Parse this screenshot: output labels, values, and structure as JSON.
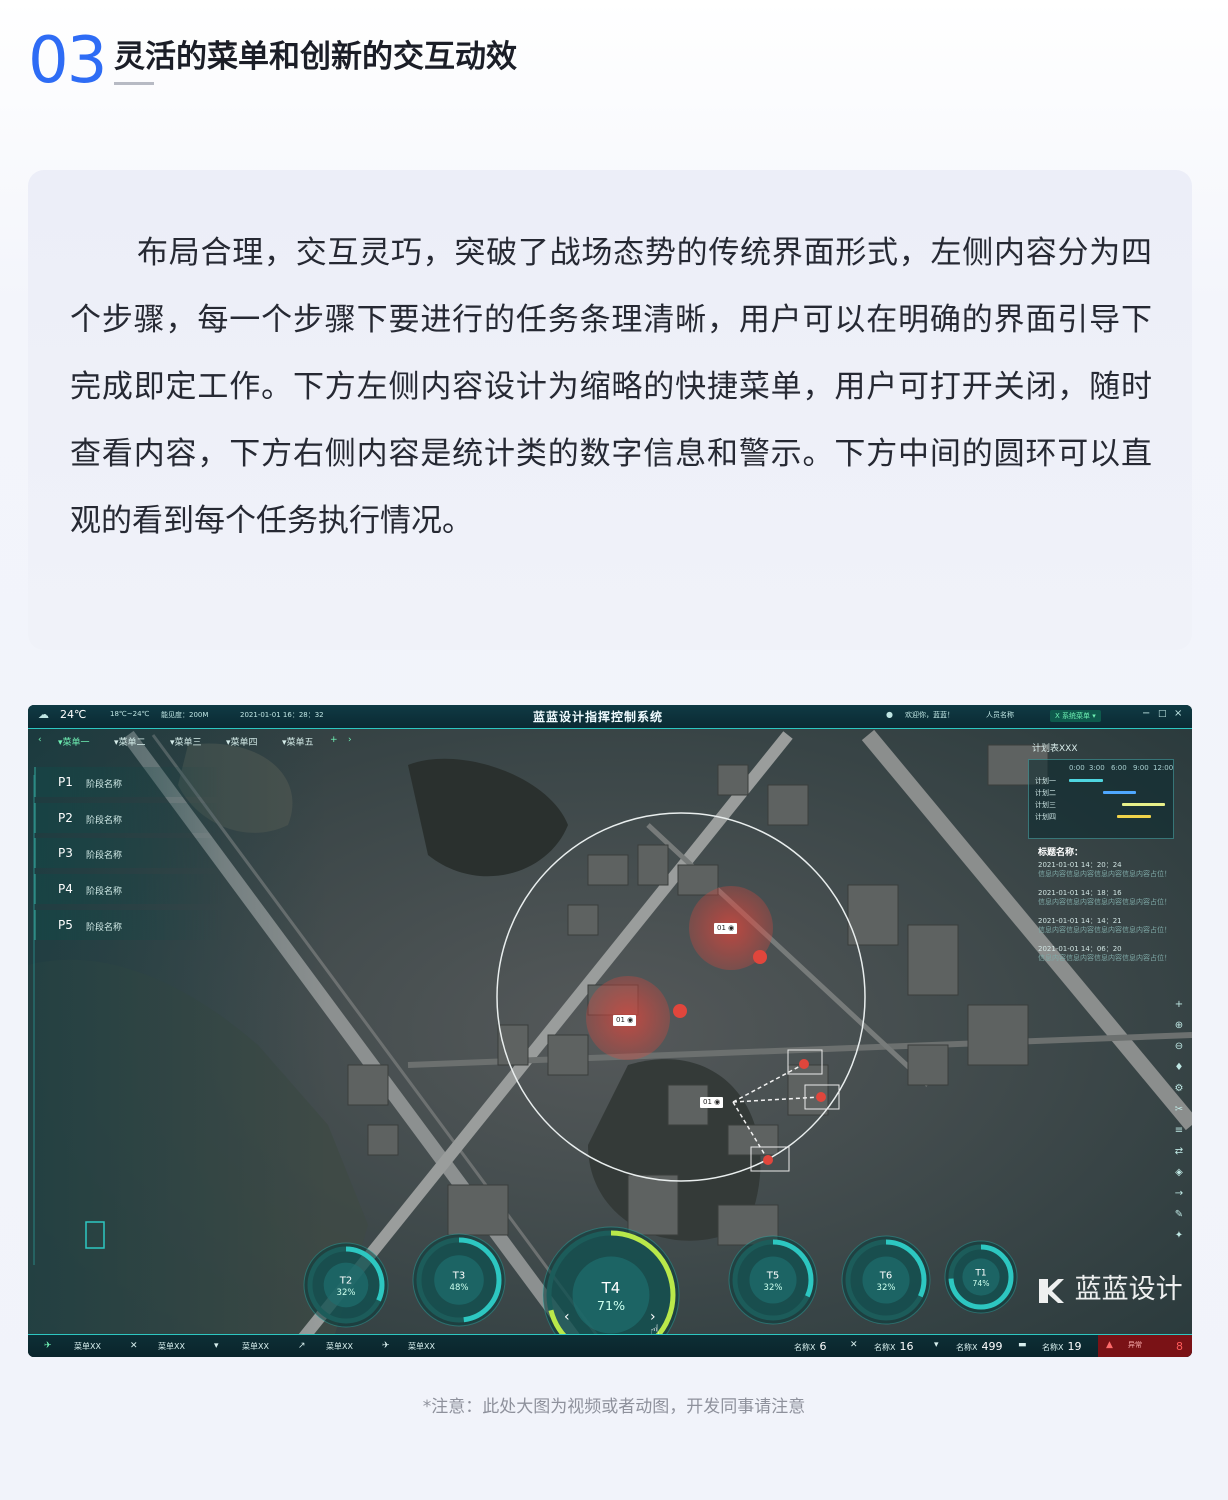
{
  "section": {
    "number": "03",
    "title": "灵活的菜单和创新的交互动效"
  },
  "description": "布局合理，交互灵巧，突破了战场态势的传统界面形式，左侧内容分为四个步骤，每一个步骤下要进行的任务条理清晰，用户可以在明确的界面引导下完成即定工作。下方左侧内容设计为缩略的快捷菜单，用户可打开关闭，随时查看内容，下方右侧内容是统计类的数字信息和警示。下方中间的圆环可以直观的看到每个任务执行情况。",
  "screen": {
    "topbar": {
      "temperature": "24℃",
      "temp_range": "18℃~24℃",
      "visibility": "能见度：200M",
      "datetime": "2021-01-01  16：28：32",
      "title": "蓝蓝设计指挥控制系统",
      "welcome": "欢迎你，蓝蓝！",
      "user_name": "人员名称",
      "system_menu": "X 系统菜单 ▾",
      "window_controls": [
        "−",
        "□",
        "×"
      ]
    },
    "menu_tabs": [
      "▾菜单一",
      "▾菜单二",
      "▾菜单三",
      "▾菜单四",
      "▾菜单五"
    ],
    "phases": [
      {
        "id": "P1",
        "name": "阶段名称"
      },
      {
        "id": "P2",
        "name": "阶段名称"
      },
      {
        "id": "P3",
        "name": "阶段名称"
      },
      {
        "id": "P4",
        "name": "阶段名称"
      },
      {
        "id": "P5",
        "name": "阶段名称"
      }
    ],
    "plan_panel": {
      "title": "计划表XXX",
      "times": [
        "0:00",
        "3:00",
        "6:00",
        "9:00",
        "12:00"
      ],
      "plans": [
        {
          "label": "计划一",
          "start": 0.0,
          "end": 0.35,
          "color": "#4fd6e0"
        },
        {
          "label": "计划二",
          "start": 0.35,
          "end": 0.7,
          "color": "#4fa8ff"
        },
        {
          "label": "计划三",
          "start": 0.55,
          "end": 1.0,
          "color": "#e8f08a"
        },
        {
          "label": "计划四",
          "start": 0.5,
          "end": 0.85,
          "color": "#f0d34a"
        }
      ],
      "alerts_title": "标题名称：",
      "alerts": [
        {
          "time": "2021-01-01 14：20：24",
          "msg": "信息内容信息内容信息内容信息内容占位！"
        },
        {
          "time": "2021-01-01 14：18：16",
          "msg": "信息内容信息内容信息内容信息内容占位！"
        },
        {
          "time": "2021-01-01 14：14：21",
          "msg": "信息内容信息内容信息内容信息内容占位！"
        },
        {
          "time": "2021-01-01 14：06：20",
          "msg": "信息内容信息内容信息内容信息内容占位！"
        }
      ]
    },
    "map_markers": [
      {
        "label": "01"
      },
      {
        "label": "01"
      },
      {
        "label": "01"
      }
    ],
    "tasks": [
      {
        "name": "T2",
        "pct": "32%",
        "value": 0.32
      },
      {
        "name": "T3",
        "pct": "48%",
        "value": 0.48
      },
      {
        "name": "T4",
        "pct": "71%",
        "value": 0.71
      },
      {
        "name": "T5",
        "pct": "32%",
        "value": 0.32
      },
      {
        "name": "T6",
        "pct": "32%",
        "value": 0.32
      },
      {
        "name": "T1",
        "pct": "74%",
        "value": 0.74
      }
    ],
    "task_nav": {
      "prev": "‹",
      "next": "›",
      "play": "▶"
    },
    "bottom_menus": [
      "菜单XX",
      "菜单XX",
      "菜单XX",
      "菜单XX",
      "菜单XX"
    ],
    "stats": [
      {
        "label": "名称X",
        "value": "6"
      },
      {
        "label": "名称X",
        "value": "16"
      },
      {
        "label": "名称X",
        "value": "499"
      },
      {
        "label": "名称X",
        "value": "19"
      }
    ],
    "alarm": {
      "label": "异常",
      "value": "8"
    },
    "logo_text": "蓝蓝设计"
  },
  "caption": "*注意：此处大图为视频或者动图，开发同事请注意",
  "colors": {
    "accent": "#2e6cf5",
    "hud_teal": "#2dc7c1",
    "marker_red": "#e0463c"
  }
}
